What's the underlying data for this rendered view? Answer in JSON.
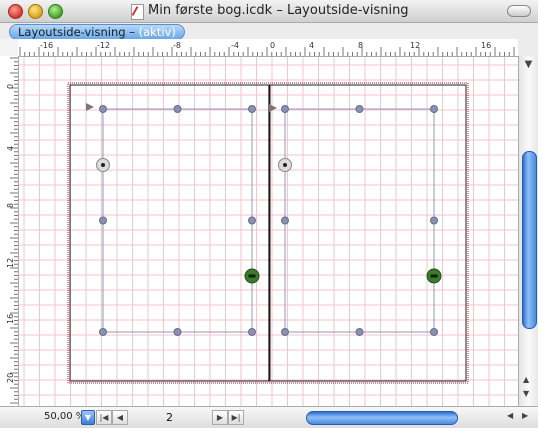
{
  "window": {
    "title": "Min første bog.icdk – Layoutside-visning"
  },
  "tab": {
    "label": "Layoutside-visning – ",
    "status": "(aktiv)"
  },
  "ruler": {
    "horizontal_labels": [
      "-16",
      "-12",
      "-8",
      "-4",
      "0",
      "4",
      "8",
      "12",
      "16"
    ],
    "vertical_labels": [
      "0",
      "4",
      "8",
      "12",
      "16",
      "20"
    ]
  },
  "bottombar": {
    "zoom_level": "50,00 %",
    "page_number": "2"
  },
  "colors": {
    "accent": "#3b7fd6",
    "margin_line": "#c8102e",
    "guide_grid": "#f3c6cc",
    "handle": "#8a90b0"
  },
  "icons": {
    "close": "close-icon",
    "minimize": "minimize-icon",
    "zoom": "zoom-icon",
    "document": "document-icon",
    "toolbar": "toolbar-toggle-icon"
  }
}
